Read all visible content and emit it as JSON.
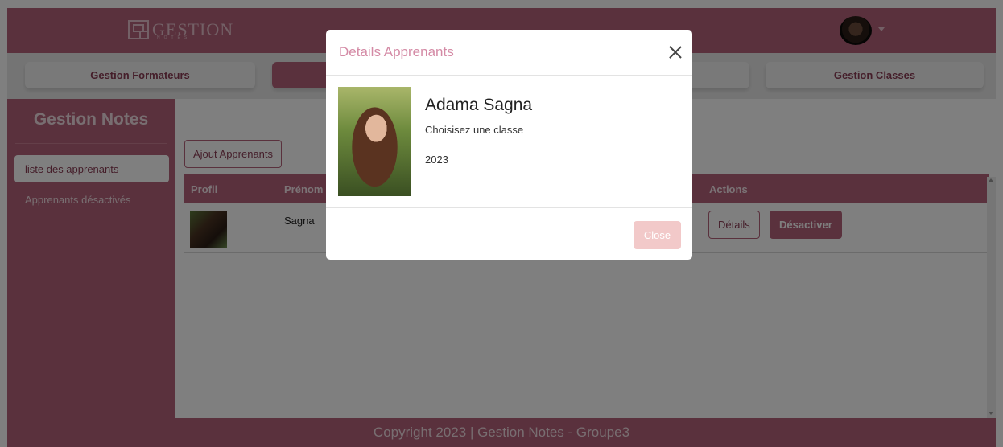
{
  "header": {
    "logo_text": "GESTION",
    "logo_sub": "NOTES"
  },
  "tabs": [
    {
      "label": "Gestion Formateurs"
    },
    {
      "label": ""
    },
    {
      "label": ""
    },
    {
      "label": "Gestion Classes"
    }
  ],
  "sidebar": {
    "title": "Gestion Notes",
    "items": [
      {
        "label": "liste des apprenants"
      },
      {
        "label": "Apprenants désactivés"
      }
    ]
  },
  "main": {
    "add_button": "Ajout Apprenants",
    "columns": [
      "Profil",
      "Prénom",
      "Actions"
    ],
    "rows": [
      {
        "prenom": "Sagna",
        "details_button": "Détails",
        "deactivate_button": "Désactiver"
      }
    ]
  },
  "footer": {
    "text": "Copyright 2023 | Gestion Notes - Groupe3"
  },
  "modal": {
    "title": "Details Apprenants",
    "name": "Adama Sagna",
    "class_text": "Choisisez une classe",
    "year": "2023",
    "close_button": "Close"
  },
  "colors": {
    "brand": "#b4637a",
    "modal_title": "#d48aa5",
    "close_button": "#f2c9c9"
  }
}
